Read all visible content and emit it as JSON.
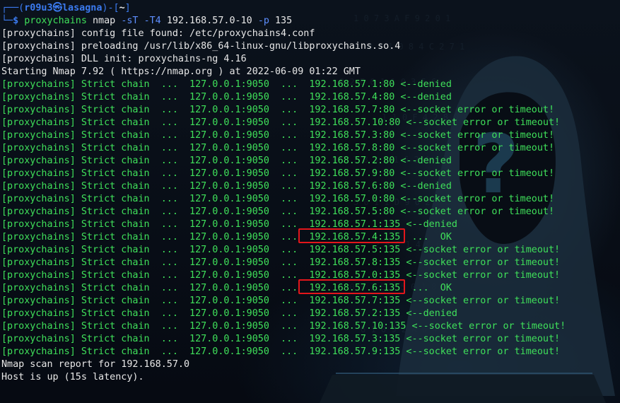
{
  "prompt": {
    "frame_top": "┌──(",
    "user": "r09u3",
    "at_symbol": "㉿",
    "host": "lasagna",
    "frame_mid": ")-[",
    "cwd": "~",
    "frame_end": "]",
    "frame_bottom": "└─",
    "dollar": "$"
  },
  "command": {
    "name": "proxychains",
    "program": "nmap",
    "flag1": "-sT",
    "flag2": "-T4",
    "target": "192.168.57.0-10",
    "flag3": "-p",
    "port": "135"
  },
  "header_lines": [
    "[proxychains] config file found: /etc/proxychains4.conf",
    "[proxychains] preloading /usr/lib/x86_64-linux-gnu/libproxychains.so.4",
    "[proxychains] DLL init: proxychains-ng 4.16",
    "Starting Nmap 7.92 ( https://nmap.org ) at 2022-06-09 01:22 GMT"
  ],
  "chain_prefix": "[proxychains] Strict chain  ...  127.0.0.1:9050  ...  ",
  "chain_lines": [
    {
      "target": "192.168.57.1:80",
      "result": " <--denied",
      "highlighted": false
    },
    {
      "target": "192.168.57.4:80",
      "result": " <--denied",
      "highlighted": false
    },
    {
      "target": "192.168.57.7:80",
      "result": " <--socket error or timeout!",
      "highlighted": false
    },
    {
      "target": "192.168.57.10:80",
      "result": " <--socket error or timeout!",
      "highlighted": false
    },
    {
      "target": "192.168.57.3:80",
      "result": " <--socket error or timeout!",
      "highlighted": false
    },
    {
      "target": "192.168.57.8:80",
      "result": " <--socket error or timeout!",
      "highlighted": false
    },
    {
      "target": "192.168.57.2:80",
      "result": " <--denied",
      "highlighted": false
    },
    {
      "target": "192.168.57.9:80",
      "result": " <--socket error or timeout!",
      "highlighted": false
    },
    {
      "target": "192.168.57.6:80",
      "result": " <--denied",
      "highlighted": false
    },
    {
      "target": "192.168.57.0:80",
      "result": " <--socket error or timeout!",
      "highlighted": false
    },
    {
      "target": "192.168.57.5:80",
      "result": " <--socket error or timeout!",
      "highlighted": false
    },
    {
      "target": "192.168.57.1:135",
      "result": " <--denied",
      "highlighted": false
    },
    {
      "target": "192.168.57.4:135",
      "result": "  ...  OK",
      "highlighted": true
    },
    {
      "target": "192.168.57.5:135",
      "result": " <--socket error or timeout!",
      "highlighted": false
    },
    {
      "target": "192.168.57.8:135",
      "result": " <--socket error or timeout!",
      "highlighted": false
    },
    {
      "target": "192.168.57.0:135",
      "result": " <--socket error or timeout!",
      "highlighted": false
    },
    {
      "target": "192.168.57.6:135",
      "result": "  ...  OK",
      "highlighted": true
    },
    {
      "target": "192.168.57.7:135",
      "result": " <--socket error or timeout!",
      "highlighted": false
    },
    {
      "target": "192.168.57.2:135",
      "result": " <--denied",
      "highlighted": false
    },
    {
      "target": "192.168.57.10:135",
      "result": " <--socket error or timeout!",
      "highlighted": false
    },
    {
      "target": "192.168.57.3:135",
      "result": " <--socket error or timeout!",
      "highlighted": false
    },
    {
      "target": "192.168.57.9:135",
      "result": " <--socket error or timeout!",
      "highlighted": false
    }
  ],
  "footer_lines": [
    "Nmap scan report for 192.168.57.0",
    "Host is up (15s latency)."
  ],
  "colors": {
    "text_green": "#3fe05a",
    "prompt_blue": "#3b7bf0",
    "flag_blue": "#5e8fff",
    "highlight_red": "#e3161b",
    "background": "#070c14"
  }
}
